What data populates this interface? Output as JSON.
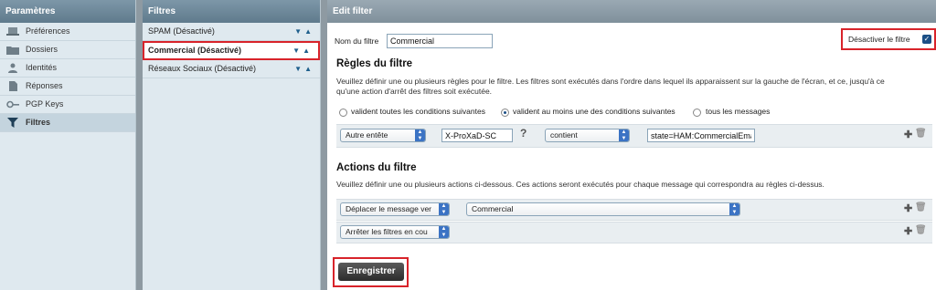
{
  "settings": {
    "title": "Paramètres",
    "items": [
      {
        "label": "Préférences",
        "icon": "laptop-icon"
      },
      {
        "label": "Dossiers",
        "icon": "folder-icon"
      },
      {
        "label": "Identités",
        "icon": "person-icon"
      },
      {
        "label": "Réponses",
        "icon": "document-icon"
      },
      {
        "label": "PGP Keys",
        "icon": "key-icon"
      },
      {
        "label": "Filtres",
        "icon": "funnel-icon",
        "active": true
      }
    ]
  },
  "filters": {
    "title": "Filtres",
    "items": [
      {
        "label": "SPAM (Désactivé)"
      },
      {
        "label": "Commercial (Désactivé)",
        "selected": true
      },
      {
        "label": "Réseaux Sociaux (Désactivé)"
      }
    ]
  },
  "editor": {
    "title": "Edit filter",
    "name_label": "Nom du filtre",
    "name_value": "Commercial",
    "disable_label": "Désactiver le filtre",
    "disable_checked": true,
    "rules_title": "Règles du filtre",
    "rules_desc_1": "Veuillez définir une ou plusieurs règles pour le filtre. Les filtres sont exécutés dans l'ordre dans lequel ils apparaissent sur la gauche de l'écran, et ce, jusqu'à ce",
    "rules_desc_2": "qu'une action d'arrêt des filtres soit exécutée.",
    "radio_all": "valident toutes les conditions suivantes",
    "radio_any": "valident au moins une des conditions suivantes",
    "radio_every": "tous les messages",
    "rule": {
      "header_select": "Autre entête",
      "header_name": "X-ProXaD-SC",
      "help": "?",
      "op_select": "contient",
      "value": "state=HAM:CommercialEma"
    },
    "actions_title": "Actions du filtre",
    "actions_desc": "Veuillez définir une ou plusieurs actions ci-dessous. Ces actions seront exécutés pour chaque message qui correspondra au règles ci-dessus.",
    "action1": {
      "select": "Déplacer le message ver",
      "target": "Commercial"
    },
    "action2": {
      "select": "Arrêter les filtres en cou"
    },
    "save_label": "Enregistrer",
    "accent": "#d8232a"
  }
}
